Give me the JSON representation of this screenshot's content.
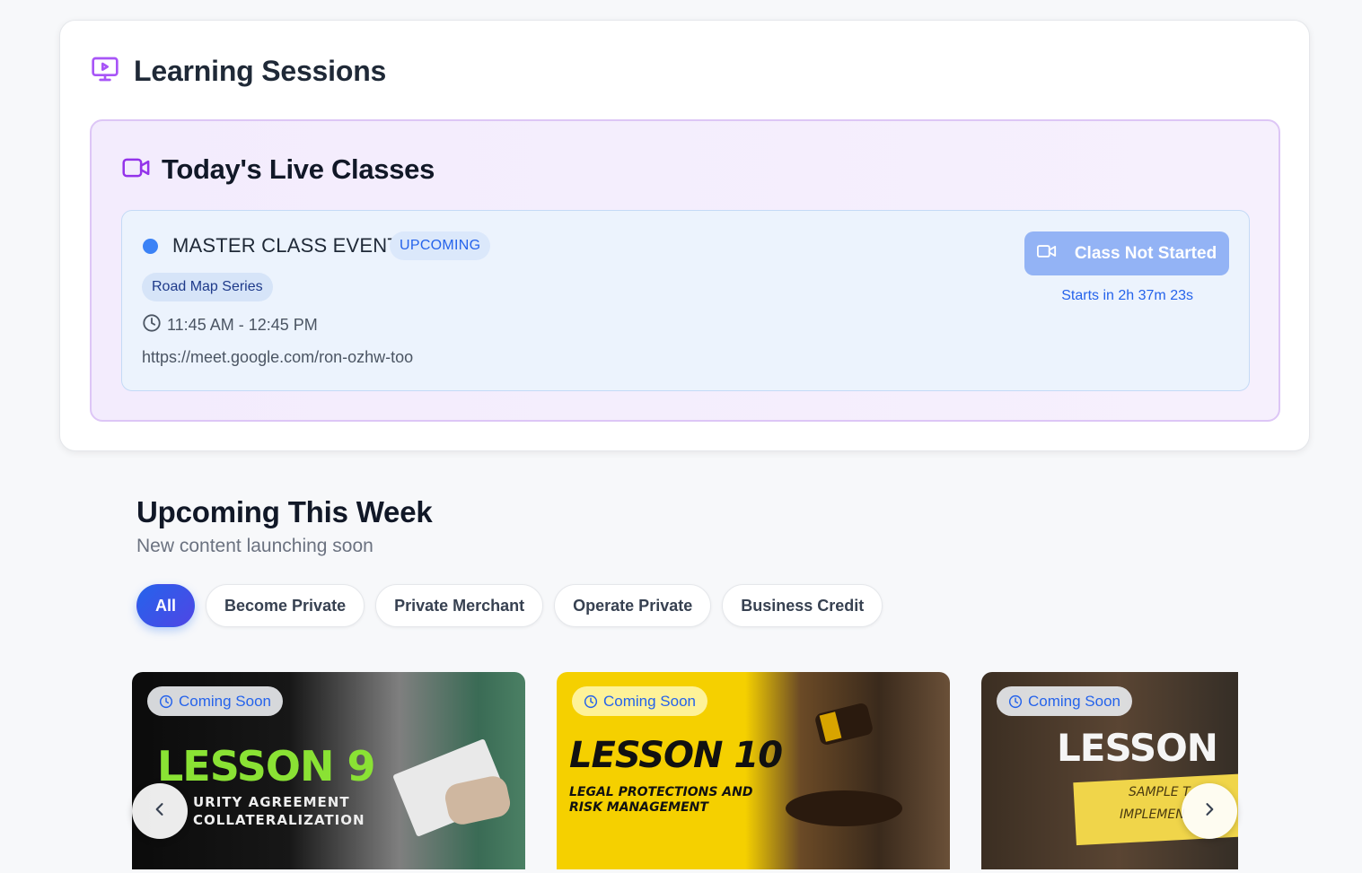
{
  "sessions": {
    "title": "Learning Sessions",
    "icon": "monitor-play-icon"
  },
  "live": {
    "title": "Today's Live Classes",
    "icon": "video-camera-icon",
    "class": {
      "name": "MASTER CLASS EVENT",
      "status": "UPCOMING",
      "series": "Road Map Series",
      "time": "11:45 AM - 12:45 PM",
      "link": "https://meet.google.com/ron-ozhw-too",
      "button_label": "Class Not Started",
      "countdown": "Starts in 2h 37m 23s"
    }
  },
  "upcoming": {
    "title": "Upcoming This Week",
    "subtitle": "New content launching soon",
    "filters": [
      "All",
      "Become Private",
      "Private Merchant",
      "Operate Private",
      "Business Credit"
    ],
    "active_filter": "All",
    "cards": [
      {
        "badge": "Coming Soon",
        "lesson_word": "LESSON 9",
        "subtitle_lines": [
          "URITY AGREEMENT",
          "COLLATERALIZATION"
        ],
        "accent": "#8ae234"
      },
      {
        "badge": "Coming Soon",
        "lesson_word": "LESSON 10",
        "subtitle_lines": [
          "LEGAL PROTECTIONS AND",
          "RISK MANAGEMENT"
        ],
        "accent": "#f5d000"
      },
      {
        "badge": "Coming Soon",
        "lesson_word": "LESSON",
        "subtitle_lines": [
          "SAMPLE T",
          "IMPLEMEN"
        ],
        "accent": "#f0d54a"
      }
    ]
  },
  "colors": {
    "accent_purple": "#a855f7",
    "accent_blue": "#3b82f6",
    "button_disabled": "#93b3f5"
  }
}
